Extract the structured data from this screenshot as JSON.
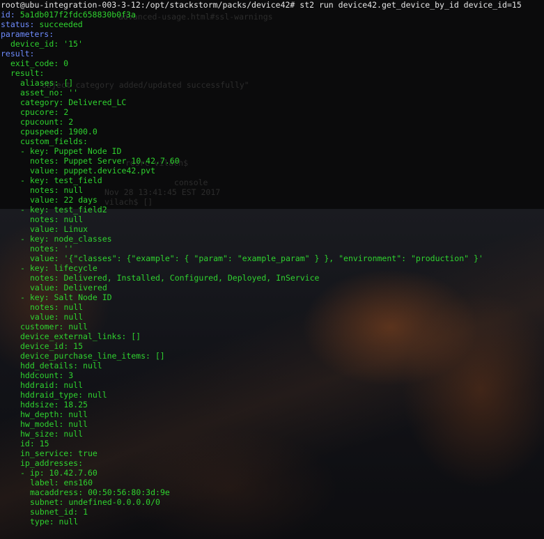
{
  "prompt": {
    "user_host_path": "root@ubu-integration-003-3-12:/opt/stackstorm/packs/device42#",
    "command": " st2 run device42.get_device_by_id device_id=15"
  },
  "background_ghost_text": [
    "advanced-usage.html#ssl-warnings",
    "object category added/updated successfully\"",
    "rosrc vilach$",
    "console",
    "Nov 28 13:41:45 EST 2017",
    "vilach$ []"
  ],
  "output_lines": [
    {
      "indent": 0,
      "key": "id:",
      "value": " 5a1db017f2fdc658830b0f3a",
      "top": true
    },
    {
      "indent": 0,
      "key": "status:",
      "value": " succeeded",
      "top": true
    },
    {
      "indent": 0,
      "key": "parameters:",
      "value": "",
      "top": true
    },
    {
      "indent": 1,
      "key": "device_id:",
      "value": " '15'"
    },
    {
      "indent": 0,
      "key": "result:",
      "value": "",
      "top": true
    },
    {
      "indent": 1,
      "key": "exit_code:",
      "value": " 0"
    },
    {
      "indent": 1,
      "key": "result:",
      "value": ""
    },
    {
      "indent": 2,
      "key": "aliases:",
      "value": " []"
    },
    {
      "indent": 2,
      "key": "asset_no:",
      "value": " ''"
    },
    {
      "indent": 2,
      "key": "category:",
      "value": " Delivered_LC"
    },
    {
      "indent": 2,
      "key": "cpucore:",
      "value": " 2"
    },
    {
      "indent": 2,
      "key": "cpucount:",
      "value": " 2"
    },
    {
      "indent": 2,
      "key": "cpuspeed:",
      "value": " 1900.0"
    },
    {
      "indent": 2,
      "key": "custom_fields:",
      "value": ""
    },
    {
      "indent": 2,
      "key": "- key:",
      "value": " Puppet Node ID"
    },
    {
      "indent": 3,
      "key": "notes:",
      "value": " Puppet Server 10.42.7.60"
    },
    {
      "indent": 3,
      "key": "value:",
      "value": " puppet.device42.pvt"
    },
    {
      "indent": 2,
      "key": "- key:",
      "value": " test_field"
    },
    {
      "indent": 3,
      "key": "notes:",
      "value": " null"
    },
    {
      "indent": 3,
      "key": "value:",
      "value": " 22 days"
    },
    {
      "indent": 2,
      "key": "- key:",
      "value": " test_field2"
    },
    {
      "indent": 3,
      "key": "notes:",
      "value": " null"
    },
    {
      "indent": 3,
      "key": "value:",
      "value": " Linux"
    },
    {
      "indent": 2,
      "key": "- key:",
      "value": " node_classes"
    },
    {
      "indent": 3,
      "key": "notes:",
      "value": " ''"
    },
    {
      "indent": 3,
      "key": "value:",
      "value": " '{\"classes\": {\"example\": { \"param\": \"example_param\" } }, \"environment\": \"production\" }'"
    },
    {
      "indent": 2,
      "key": "- key:",
      "value": " lifecycle"
    },
    {
      "indent": 3,
      "key": "notes:",
      "value": " Delivered, Installed, Configured, Deployed, InService"
    },
    {
      "indent": 3,
      "key": "value:",
      "value": " Delivered"
    },
    {
      "indent": 2,
      "key": "- key:",
      "value": " Salt Node ID"
    },
    {
      "indent": 3,
      "key": "notes:",
      "value": " null"
    },
    {
      "indent": 3,
      "key": "value:",
      "value": " null"
    },
    {
      "indent": 2,
      "key": "customer:",
      "value": " null"
    },
    {
      "indent": 2,
      "key": "device_external_links:",
      "value": " []"
    },
    {
      "indent": 2,
      "key": "device_id:",
      "value": " 15"
    },
    {
      "indent": 2,
      "key": "device_purchase_line_items:",
      "value": " []"
    },
    {
      "indent": 2,
      "key": "hdd_details:",
      "value": " null"
    },
    {
      "indent": 2,
      "key": "hddcount:",
      "value": " 3"
    },
    {
      "indent": 2,
      "key": "hddraid:",
      "value": " null"
    },
    {
      "indent": 2,
      "key": "hddraid_type:",
      "value": " null"
    },
    {
      "indent": 2,
      "key": "hddsize:",
      "value": " 18.25"
    },
    {
      "indent": 2,
      "key": "hw_depth:",
      "value": " null"
    },
    {
      "indent": 2,
      "key": "hw_model:",
      "value": " null"
    },
    {
      "indent": 2,
      "key": "hw_size:",
      "value": " null"
    },
    {
      "indent": 2,
      "key": "id:",
      "value": " 15"
    },
    {
      "indent": 2,
      "key": "in_service:",
      "value": " true"
    },
    {
      "indent": 2,
      "key": "ip_addresses:",
      "value": ""
    },
    {
      "indent": 2,
      "key": "- ip:",
      "value": " 10.42.7.60"
    },
    {
      "indent": 3,
      "key": "label:",
      "value": " ens160"
    },
    {
      "indent": 3,
      "key": "macaddress:",
      "value": " 00:50:56:80:3d:9e"
    },
    {
      "indent": 3,
      "key": "subnet:",
      "value": " undefined-0.0.0.0/0"
    },
    {
      "indent": 3,
      "key": "subnet_id:",
      "value": " 1"
    },
    {
      "indent": 3,
      "key": "type:",
      "value": " null"
    }
  ]
}
